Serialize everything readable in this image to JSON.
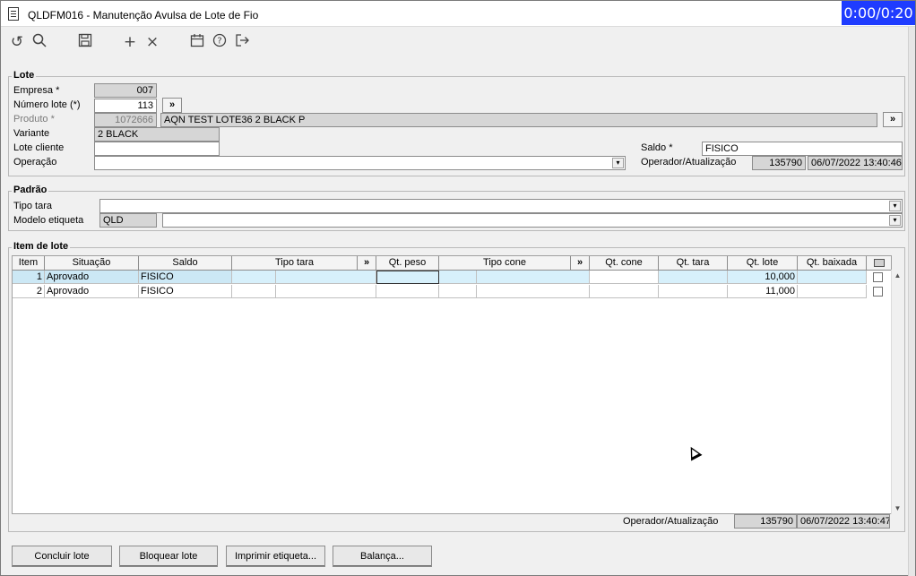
{
  "window": {
    "title": "QLDFM016 - Manutenção Avulsa de Lote de Fio",
    "timer": "0:00/0:20"
  },
  "toolbar": {
    "icons": [
      "undo-icon",
      "search-icon",
      "save-icon",
      "add-icon",
      "delete-icon",
      "calendar-icon",
      "help-icon",
      "exit-icon"
    ]
  },
  "lote": {
    "legend": "Lote",
    "empresa_label": "Empresa *",
    "empresa_value": "007",
    "numero_label": "Número lote (*)",
    "numero_value": "113",
    "numero_btn": "»",
    "produto_label": "Produto *",
    "produto_code": "1072666",
    "produto_desc": "AQN TEST LOTE36 2 BLACK P",
    "produto_btn": "»",
    "variante_label": "Variante",
    "variante_value": "2 BLACK",
    "lote_cliente_label": "Lote cliente",
    "lote_cliente_value": "",
    "saldo_label": "Saldo *",
    "saldo_value": "FISICO",
    "operacao_label": "Operação",
    "operacao_value": "",
    "operador_label": "Operador/Atualização",
    "operador_value": "135790",
    "atualizacao_value": "06/07/2022 13:40:46"
  },
  "padrao": {
    "legend": "Padrão",
    "tipo_tara_label": "Tipo tara",
    "tipo_tara_value": "",
    "modelo_label": "Modelo etiqueta",
    "modelo_code": "QLD",
    "modelo_desc": ""
  },
  "itens": {
    "legend": "Item de lote",
    "columns": [
      "Item",
      "Situação",
      "Saldo",
      "Tipo tara",
      "»",
      "Qt. peso",
      "Tipo cone",
      "»",
      "Qt. cone",
      "Qt. tara",
      "Qt. lote",
      "Qt. baixada"
    ],
    "rows": [
      {
        "item": "1",
        "situacao": "Aprovado",
        "saldo": "FISICO",
        "qt_lote": "10,000"
      },
      {
        "item": "2",
        "situacao": "Aprovado",
        "saldo": "FISICO",
        "qt_lote": "11,000"
      }
    ],
    "operador_label": "Operador/Atualização",
    "operador_value": "135790",
    "atualizacao_value": "06/07/2022 13:40:47"
  },
  "actions": {
    "concluir": "Concluir lote",
    "bloquear": "Bloquear lote",
    "imprimir": "Imprimir etiqueta...",
    "balanca": "Balança..."
  }
}
